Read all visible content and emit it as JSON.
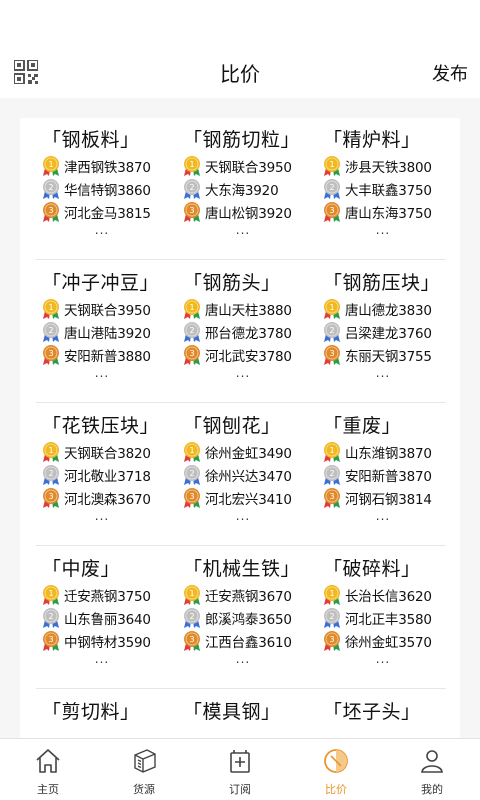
{
  "header": {
    "title": "比价",
    "publish": "发布"
  },
  "colors": {
    "accent": "#e8962a",
    "gold": "#f2b820",
    "silver": "#bfbfbf",
    "bronze": "#e08a2a"
  },
  "groups": [
    {
      "cats": [
        {
          "title": "「钢板料」",
          "items": [
            "津西钢铁3870",
            "华信特钢3860",
            "河北金马3815"
          ],
          "more": "..."
        },
        {
          "title": "「钢筋切粒」",
          "items": [
            "天钢联合3950",
            "大东海3920",
            "唐山松钢3920"
          ],
          "more": "..."
        },
        {
          "title": "「精炉料」",
          "items": [
            "涉县天铁3800",
            "大丰联鑫3750",
            "唐山东海3750"
          ],
          "more": "..."
        }
      ]
    },
    {
      "cats": [
        {
          "title": "「冲子冲豆」",
          "items": [
            "天钢联合3950",
            "唐山港陆3920",
            "安阳新普3880"
          ],
          "more": "..."
        },
        {
          "title": "「钢筋头」",
          "items": [
            "唐山天柱3880",
            "邢台德龙3780",
            "河北武安3780"
          ],
          "more": "..."
        },
        {
          "title": "「钢筋压块」",
          "items": [
            "唐山德龙3830",
            "吕梁建龙3760",
            "东丽天钢3755"
          ],
          "more": "..."
        }
      ]
    },
    {
      "cats": [
        {
          "title": "「花铁压块」",
          "items": [
            "天钢联合3820",
            "河北敬业3718",
            "河北澳森3670"
          ],
          "more": "..."
        },
        {
          "title": "「钢刨花」",
          "items": [
            "徐州金虹3490",
            "徐州兴达3470",
            "河北宏兴3410"
          ],
          "more": "..."
        },
        {
          "title": "「重废」",
          "items": [
            "山东潍钢3870",
            "安阳新普3870",
            "河钢石钢3814"
          ],
          "more": "..."
        }
      ]
    },
    {
      "cats": [
        {
          "title": "「中废」",
          "items": [
            "迁安燕钢3750",
            "山东鲁丽3640",
            "中钢特材3590"
          ],
          "more": "..."
        },
        {
          "title": "「机械生铁」",
          "items": [
            "迁安燕钢3670",
            "郎溪鸿泰3650",
            "江西台鑫3610"
          ],
          "more": "..."
        },
        {
          "title": "「破碎料」",
          "items": [
            "长治长信3620",
            "河北正丰3580",
            "徐州金虹3570"
          ],
          "more": "..."
        }
      ]
    },
    {
      "cats": [
        {
          "title": "「剪切料」",
          "items": [],
          "more": ""
        },
        {
          "title": "「模具钢」",
          "items": [],
          "more": ""
        },
        {
          "title": "「坯子头」",
          "items": [],
          "more": ""
        }
      ]
    }
  ],
  "tabs": [
    {
      "label": "主页",
      "icon": "home-icon"
    },
    {
      "label": "货源",
      "icon": "goods-icon"
    },
    {
      "label": "订阅",
      "icon": "subscribe-icon"
    },
    {
      "label": "比价",
      "icon": "compare-icon",
      "active": true
    },
    {
      "label": "我的",
      "icon": "profile-icon"
    }
  ]
}
